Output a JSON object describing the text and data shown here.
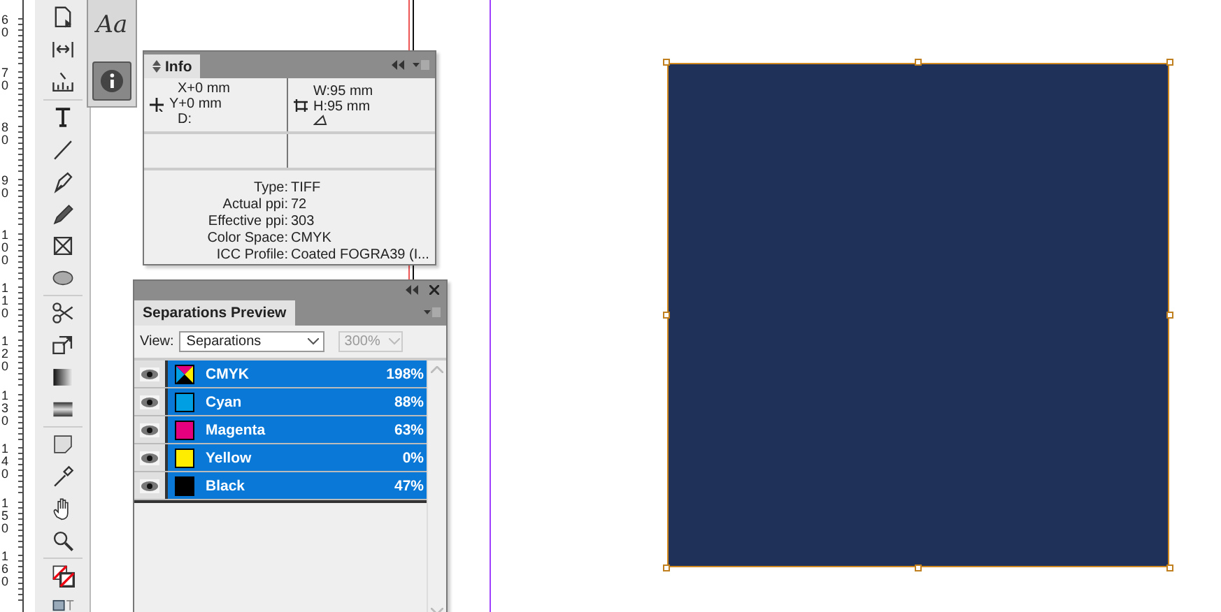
{
  "ruler": {
    "labels": [
      "60",
      "70",
      "80",
      "90",
      "100",
      "110",
      "120",
      "130",
      "140",
      "150",
      "160"
    ]
  },
  "dock": {
    "items": [
      {
        "kind": "text",
        "label": "Aa",
        "selected": false
      },
      {
        "kind": "info",
        "selected": true
      }
    ]
  },
  "info_panel": {
    "title": "Info",
    "position": [
      "X+0 mm",
      "Y+0 mm",
      "D:"
    ],
    "size": [
      "W:95 mm",
      "H:95 mm"
    ],
    "properties": [
      {
        "label": "Type:",
        "value": "TIFF"
      },
      {
        "label": "Actual ppi:",
        "value": "72"
      },
      {
        "label": "Effective ppi:",
        "value": "303"
      },
      {
        "label": "Color Space:",
        "value": "CMYK"
      },
      {
        "label": "ICC Profile:",
        "value": "Coated FOGRA39 (I..."
      }
    ]
  },
  "separations_panel": {
    "title": "Separations Preview",
    "view_label": "View:",
    "view_value": "Separations",
    "zoom": {
      "value": "300%",
      "disabled": true
    },
    "rows": [
      {
        "name": "CMYK",
        "percent": "198%",
        "kind": "composite",
        "visible": true,
        "selected": true
      },
      {
        "name": "Cyan",
        "percent": "88%",
        "kind": "ink",
        "color": "#009fe3",
        "visible": true,
        "selected": true
      },
      {
        "name": "Magenta",
        "percent": "63%",
        "kind": "ink",
        "color": "#e5007d",
        "visible": true,
        "selected": true
      },
      {
        "name": "Yellow",
        "percent": "0%",
        "kind": "ink",
        "color": "#ffed00",
        "visible": true,
        "selected": true
      },
      {
        "name": "Black",
        "percent": "47%",
        "kind": "ink",
        "color": "#000000",
        "visible": true,
        "selected": true
      }
    ]
  },
  "canvas": {
    "frame": {
      "color": "#1f3059",
      "selected": true
    }
  }
}
